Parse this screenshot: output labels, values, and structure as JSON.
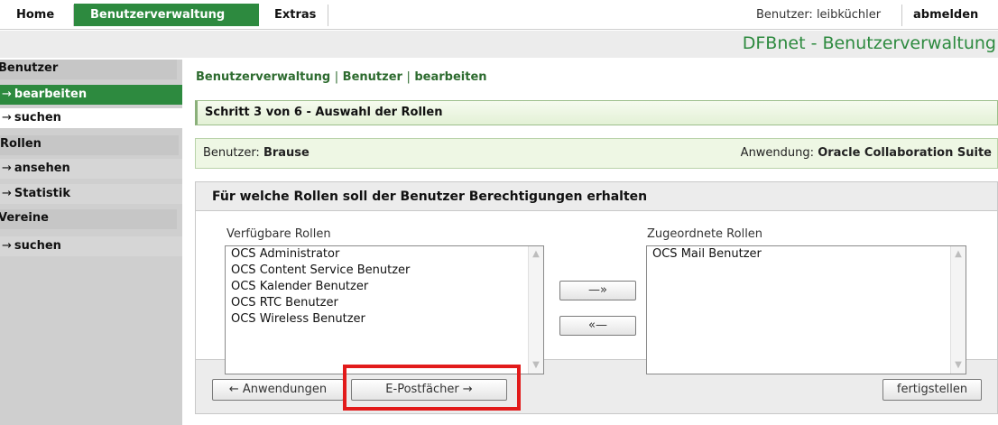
{
  "nav": {
    "tabs": [
      {
        "label": "Home"
      },
      {
        "label": "Benutzerverwaltung"
      },
      {
        "label": "Extras"
      }
    ],
    "user_text": "Benutzer: leibküchler",
    "logout_label": "abmelden"
  },
  "header": {
    "brand": "DFBnet - Benutzerverwaltung"
  },
  "sidebar": {
    "sections": [
      {
        "title": "Benutzer",
        "items": [
          {
            "label": "bearbeiten"
          },
          {
            "label": "suchen"
          }
        ]
      },
      {
        "title": "Rollen",
        "items": [
          {
            "label": "ansehen"
          },
          {
            "label": "Statistik"
          }
        ]
      },
      {
        "title": "Vereine",
        "items": [
          {
            "label": "suchen"
          }
        ]
      }
    ],
    "arrow_glyph": "→"
  },
  "main": {
    "breadcrumb": [
      "Benutzerverwaltung",
      "Benutzer",
      "bearbeiten"
    ],
    "breadcrumb_sep": "|",
    "step_text": "Schritt 3 von 6 - Auswahl der Rollen",
    "user_label": "Benutzer:",
    "user_value": "Brause",
    "app_label": "Anwendung:",
    "app_value": "Oracle Collaboration Suite",
    "panel_title": "Für welche Rollen soll der Benutzer Berechtigungen erhalten",
    "available": {
      "label": "Verfügbare Rollen",
      "options": [
        "OCS Administrator",
        "OCS Content Service Benutzer",
        "OCS Kalender Benutzer",
        "OCS RTC Benutzer",
        "OCS Wireless Benutzer"
      ]
    },
    "assigned": {
      "label": "Zugeordnete Rollen",
      "options": [
        "OCS Mail Benutzer"
      ]
    },
    "move_right_label": "—»",
    "move_left_label": "«—",
    "back_button": "← Anwendungen",
    "next_button": "E-Postfächer →",
    "finish_button": "fertigstellen"
  },
  "colors": {
    "accent": "#2d8a3f",
    "highlight": "#e21b1b"
  }
}
